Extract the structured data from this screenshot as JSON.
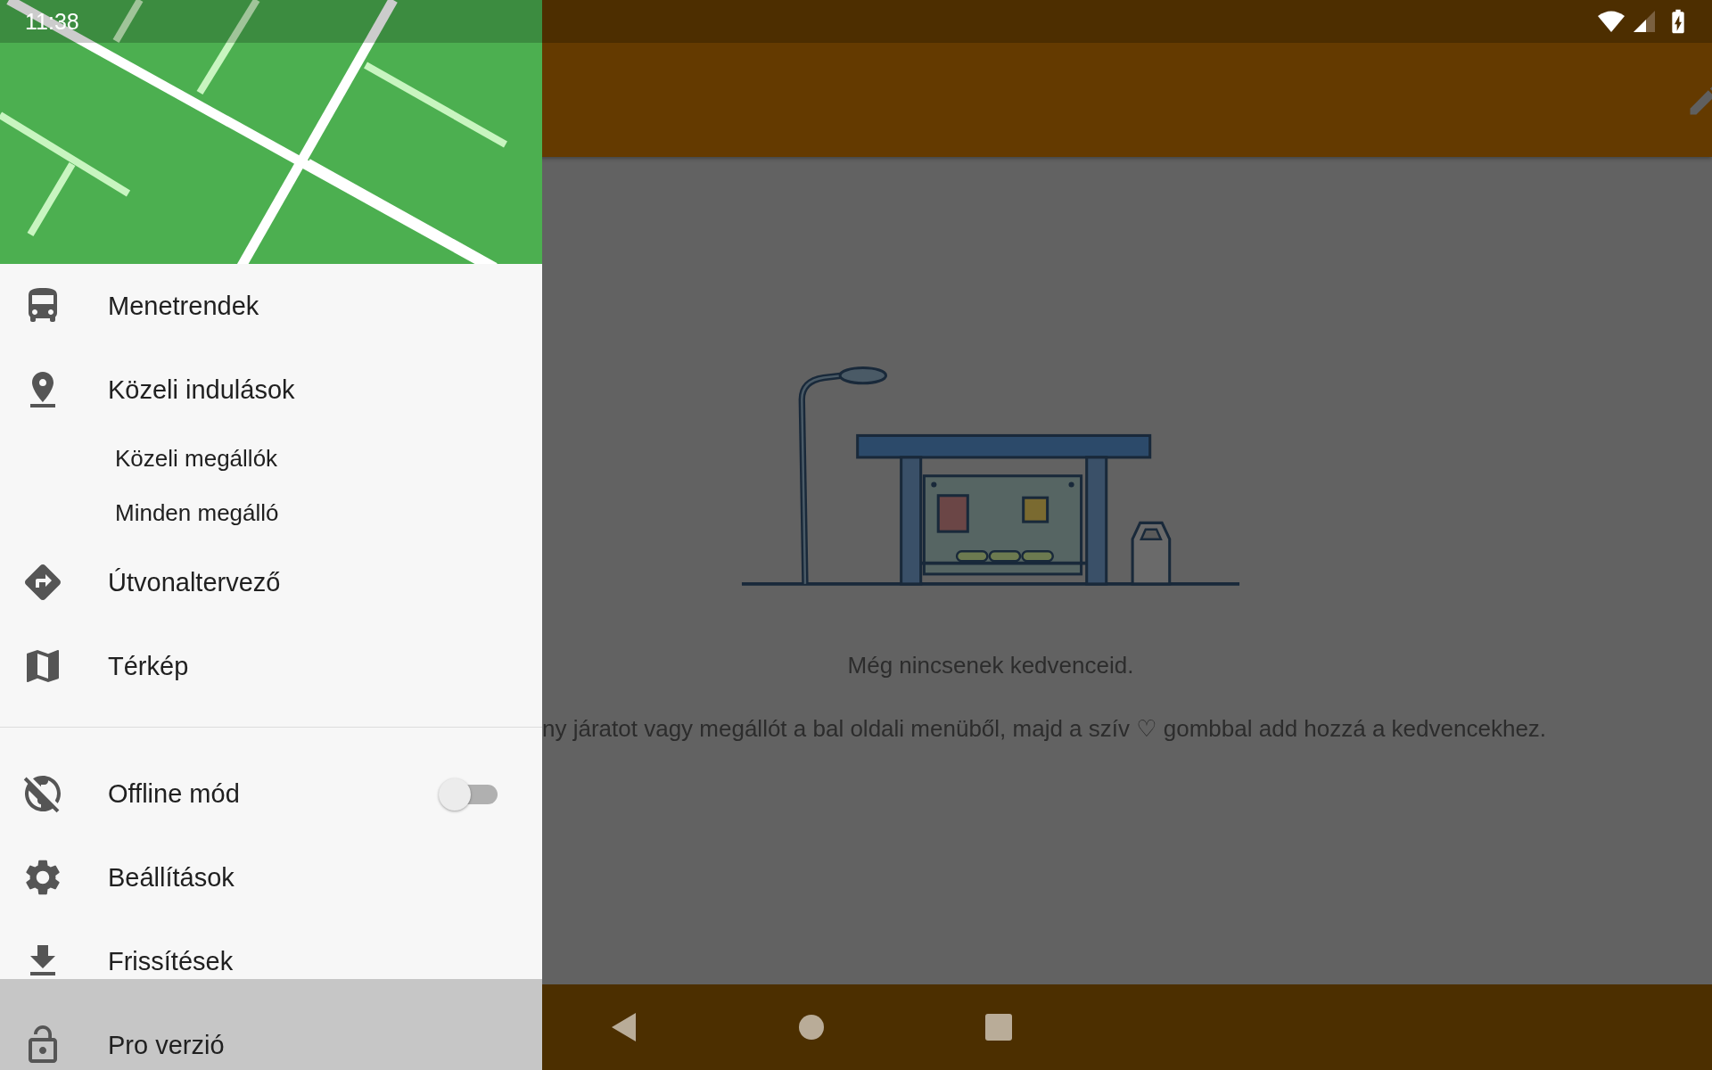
{
  "status_bar": {
    "time": "11:38"
  },
  "drawer": {
    "sections": [
      {
        "items": [
          {
            "kind": "link",
            "label": "Menetrendek",
            "selected": false
          },
          {
            "kind": "link",
            "label": "Közeli indulások",
            "selected": false,
            "children": [
              {
                "label": "Közeli megállók",
                "selected": false
              },
              {
                "label": "Minden megálló",
                "selected": false
              }
            ]
          },
          {
            "kind": "link",
            "label": "Útvonaltervező",
            "selected": false
          },
          {
            "kind": "link",
            "label": "Térkép",
            "selected": false
          }
        ]
      },
      {
        "items": [
          {
            "kind": "toggle",
            "label": "Offline mód",
            "on": false,
            "selected": false
          },
          {
            "kind": "link",
            "label": "Beállítások",
            "selected": false
          },
          {
            "kind": "link",
            "label": "Frissítések",
            "selected": false
          },
          {
            "kind": "link",
            "label": "Pro verzió",
            "selected": true
          }
        ]
      }
    ]
  },
  "empty_state": {
    "title": "Még nincsenek kedvenceid.",
    "message": "ny járatot vagy megállót a bal oldali menüből, majd a szív ♡ gombbal add hozzá a kedvencekhez."
  }
}
